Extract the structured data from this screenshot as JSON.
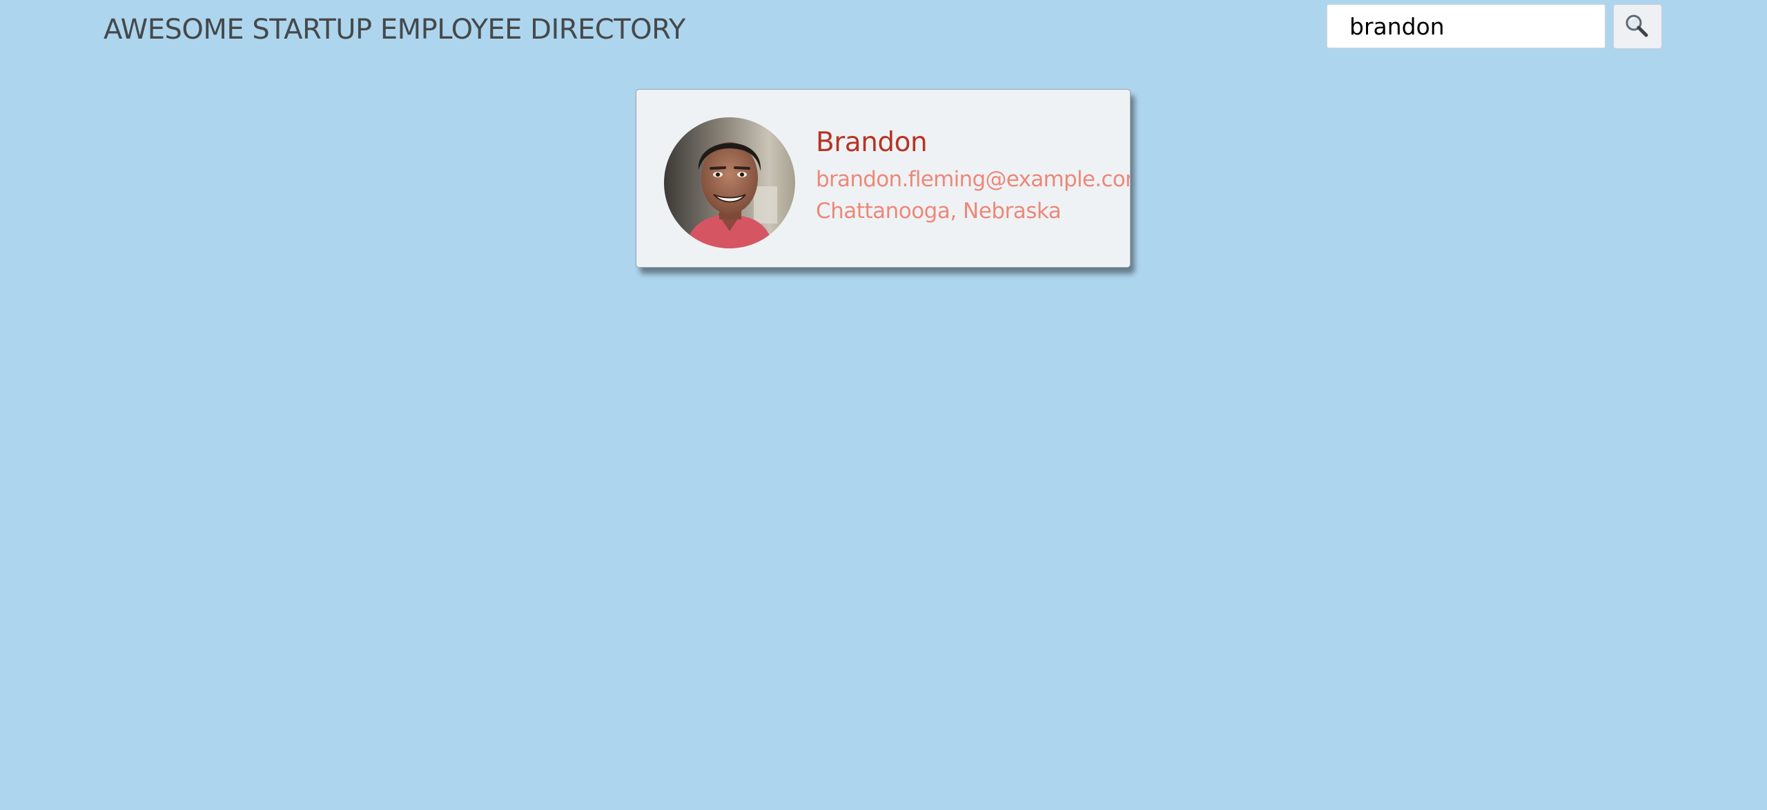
{
  "header": {
    "title": "AWESOME STARTUP EMPLOYEE DIRECTORY"
  },
  "search": {
    "value": "brandon",
    "button_icon": "magnifying-glass-icon"
  },
  "results": [
    {
      "name": "Brandon",
      "email": "brandon.fleming@example.com",
      "location": "Chattanooga, Nebraska",
      "avatar": "employee-photo"
    }
  ],
  "colors": {
    "background": "#aed5ee",
    "title": "#45494b",
    "card": "#eef2f5",
    "name": "#b73424",
    "detail": "#ed8878"
  }
}
